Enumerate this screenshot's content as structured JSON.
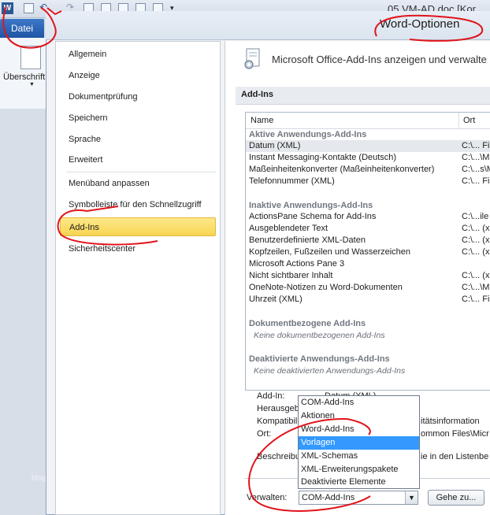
{
  "window": {
    "doc_title": "05 VM-AD.doc [Kor",
    "app_logo": "W",
    "file_tab": "Datei",
    "ribbon_label": "Überschrift",
    "watermark": "blog"
  },
  "dialog": {
    "title": "Word-Optionen",
    "nav": [
      "Allgemein",
      "Anzeige",
      "Dokumentprüfung",
      "Speichern",
      "Sprache",
      "Erweitert",
      "Menüband anpassen",
      "Symbolleiste für den Schnellzugriff",
      "Add-Ins",
      "Sicherheitscenter"
    ],
    "selected_nav": "Add-Ins",
    "header_text": "Microsoft Office-Add-Ins anzeigen und verwalte",
    "section_title": "Add-Ins",
    "columns": {
      "name": "Name",
      "location": "Ort"
    },
    "groups": {
      "active": "Aktive Anwendungs-Add-Ins",
      "inactive": "Inaktive Anwendungs-Add-Ins",
      "document": "Dokumentbezogene Add-Ins",
      "disabled": "Deaktivierte Anwendungs-Add-Ins"
    },
    "active_rows": [
      {
        "name": "Datum (XML)",
        "location": "C:\\... Fi"
      },
      {
        "name": "Instant Messaging-Kontakte (Deutsch)",
        "location": "C:\\...\\M"
      },
      {
        "name": "Maßeinheitenkonverter (Maßeinheitenkonverter)",
        "location": "C:\\...s\\M"
      },
      {
        "name": "Telefonnummer (XML)",
        "location": "C:\\... Fi"
      }
    ],
    "inactive_rows": [
      {
        "name": "ActionsPane Schema for Add-Ins",
        "location": "C:\\...ile"
      },
      {
        "name": "Ausgeblendeter Text",
        "location": "C:\\... (x"
      },
      {
        "name": "Benutzerdefinierte XML-Daten",
        "location": "C:\\... (x"
      },
      {
        "name": "Kopfzeilen, Fußzeilen und Wasserzeichen",
        "location": "C:\\... (x"
      },
      {
        "name": "Microsoft Actions Pane 3",
        "location": ""
      },
      {
        "name": "Nicht sichtbarer Inhalt",
        "location": "C:\\... (x"
      },
      {
        "name": "OneNote-Notizen zu Word-Dokumenten",
        "location": "C:\\...\\M"
      },
      {
        "name": "Uhrzeit (XML)",
        "location": "C:\\... Fi"
      }
    ],
    "document_empty": "Keine dokumentbezogenen Add-Ins",
    "disabled_empty": "Keine deaktivierten Anwendungs-Add-Ins",
    "details": {
      "addin_label": "Add-In:",
      "addin_value": "Datum (XML)",
      "publisher_label": "Herausgeber:",
      "compat_label": "Kompatibilität:",
      "compat_value": "itätsinformation",
      "location_label": "Ort:",
      "location_value": "ommon Files\\Micr",
      "description_label": "Beschreibung:",
      "description_value": "ie in den Listenbe"
    },
    "manage": {
      "label": "Verwalten:",
      "selected": "COM-Add-Ins",
      "go_button": "Gehe zu...",
      "options": [
        "COM-Add-Ins",
        "Aktionen",
        "Word-Add-Ins",
        "Vorlagen",
        "XML-Schemas",
        "XML-Erweiterungspakete",
        "Deaktivierte Elemente"
      ],
      "highlighted": "Vorlagen"
    }
  },
  "colors": {
    "selection": "#f8d451",
    "highlight": "#3399ff",
    "annotation": "#e0141b"
  }
}
